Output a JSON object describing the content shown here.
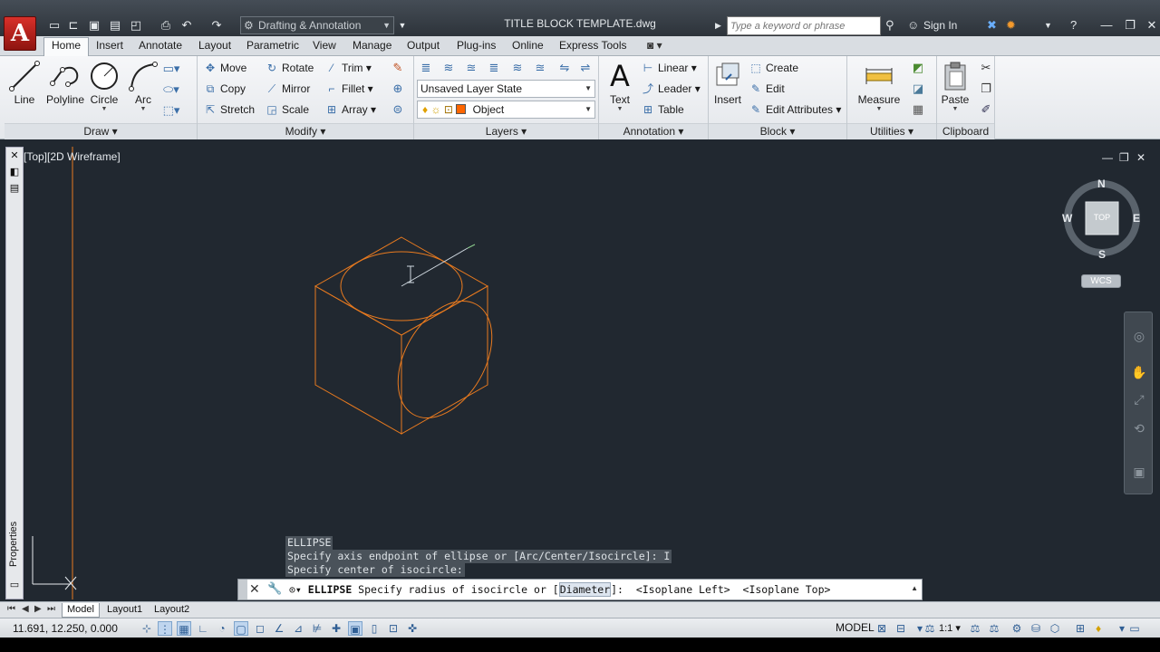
{
  "titlebar": {
    "app_logo": "A",
    "workspace": "Drafting & Annotation",
    "document_title": "TITLE BLOCK TEMPLATE.dwg",
    "search_placeholder": "Type a keyword or phrase",
    "sign_in": "Sign In"
  },
  "ribbon_tabs": [
    "Home",
    "Insert",
    "Annotate",
    "Layout",
    "Parametric",
    "View",
    "Manage",
    "Output",
    "Plug-ins",
    "Online",
    "Express Tools"
  ],
  "draw_panel": {
    "label": "Draw",
    "line": "Line",
    "polyline": "Polyline",
    "circle": "Circle",
    "arc": "Arc"
  },
  "modify_panel": {
    "label": "Modify",
    "move": "Move",
    "rotate": "Rotate",
    "trim": "Trim",
    "copy": "Copy",
    "mirror": "Mirror",
    "fillet": "Fillet",
    "stretch": "Stretch",
    "scale": "Scale",
    "array": "Array"
  },
  "layers_panel": {
    "label": "Layers",
    "layer_state": "Unsaved Layer State",
    "current_layer": "Object",
    "layer_color": "#ff6600"
  },
  "annotation_panel": {
    "label": "Annotation",
    "text": "Text",
    "text_glyph": "A",
    "linear": "Linear",
    "leader": "Leader",
    "table": "Table"
  },
  "block_panel": {
    "label": "Block",
    "insert": "Insert",
    "create": "Create",
    "edit": "Edit",
    "edit_attributes": "Edit Attributes"
  },
  "utilities_panel": {
    "label": "Utilities",
    "measure": "Measure"
  },
  "clipboard_panel": {
    "label": "Clipboard",
    "paste": "Paste"
  },
  "viewport": {
    "label": "[Top][2D Wireframe]",
    "drawing_color": "#e87a1f",
    "background": "#212830"
  },
  "viewcube": {
    "n": "N",
    "s": "S",
    "e": "E",
    "w": "W",
    "face": "TOP",
    "wcs": "WCS"
  },
  "side_palette": {
    "label": "Properties"
  },
  "command": {
    "history": [
      "ELLIPSE",
      "Specify axis endpoint of ellipse or [Arc/Center/Isocircle]: I",
      "Specify center of isocircle:"
    ],
    "current_command": "ELLIPSE",
    "prompt_before": " Specify radius of isocircle or [",
    "option_highlight": "Diameter",
    "prompt_after": "]:  <Isoplane Left>  <Isoplane Top>"
  },
  "layout_tabs": [
    "Model",
    "Layout1",
    "Layout2"
  ],
  "statusbar": {
    "coordinates": "11.691, 12.250, 0.000",
    "model": "MODEL",
    "annotation_scale": "1:1"
  }
}
